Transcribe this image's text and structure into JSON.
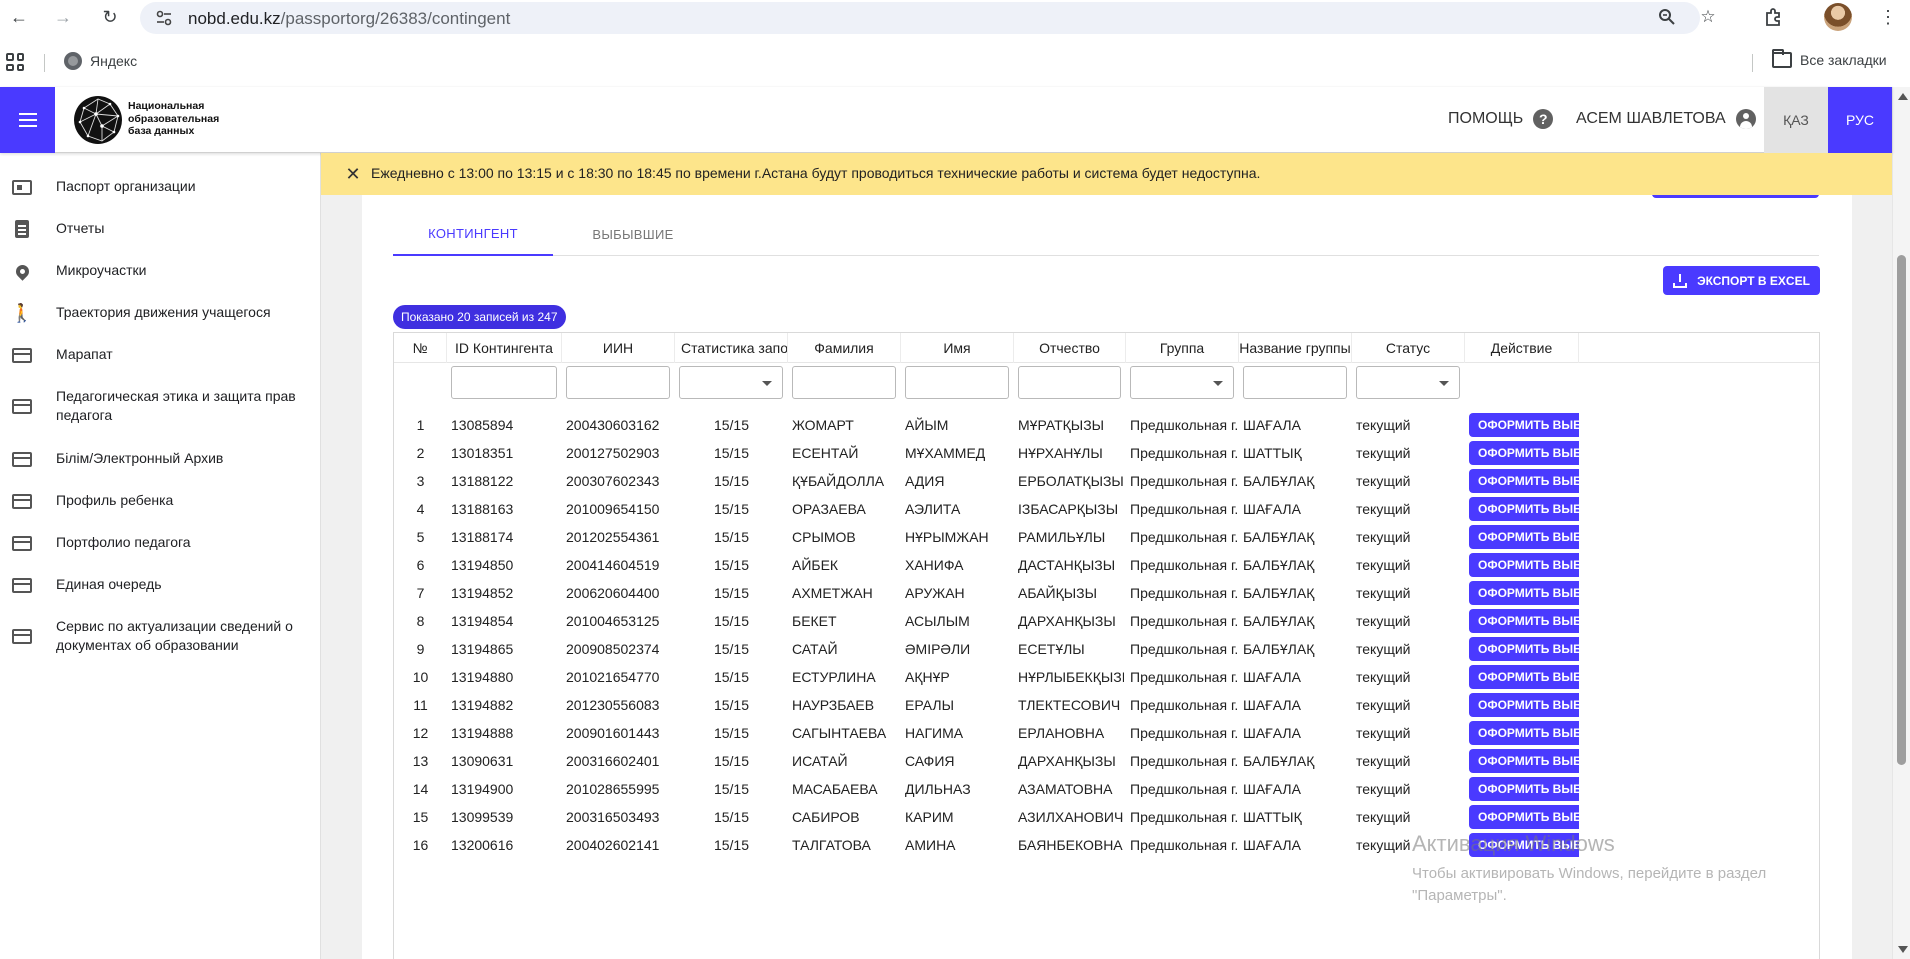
{
  "browser": {
    "url_host": "nobd.edu.kz",
    "url_path": "/passportorg/26383/contingent",
    "bookmark_yandex": "Яндекс",
    "all_bookmarks": "Все закладки"
  },
  "header": {
    "logo_text_1": "Национальная",
    "logo_text_2": "образовательная",
    "logo_text_3": "база данных",
    "help_label": "ПОМОЩЬ",
    "user_name": "АСЕМ ШАВЛЕТОВА",
    "lang_kaz": "ҚАЗ",
    "lang_rus": "РУС"
  },
  "sidebar": {
    "items": [
      {
        "label": "Паспорт организации",
        "icon": "id-card-icon"
      },
      {
        "label": "Отчеты",
        "icon": "clipboard-icon"
      },
      {
        "label": "Микроучастки",
        "icon": "map-pin-icon"
      },
      {
        "label": "Траектория движения учащегося",
        "icon": "walking-icon"
      },
      {
        "label": "Марапат",
        "icon": "table-icon"
      },
      {
        "label": "Педагогическая этика и защита прав педагога",
        "icon": "table-icon"
      },
      {
        "label": "Білім/Электронный Архив",
        "icon": "table-icon"
      },
      {
        "label": "Профиль ребенка",
        "icon": "table-icon"
      },
      {
        "label": "Портфолио педагога",
        "icon": "table-icon"
      },
      {
        "label": "Единая очередь",
        "icon": "table-icon"
      },
      {
        "label": "Сервис по актуализации сведений о документах об образовании",
        "icon": "table-icon"
      }
    ]
  },
  "banner": {
    "text": "Ежедневно с 13:00 по 13:15 и с 18:30 по 18:45 по времени г.Астана будут проводиться технические работы и система будет недоступна."
  },
  "tabs": [
    {
      "label": "КОНТИНГЕНТ",
      "active": true
    },
    {
      "label": "ВЫБЫВШИЕ",
      "active": false
    }
  ],
  "toolbar": {
    "export_label": "ЭКСПОРТ В EXCEL",
    "records_badge": "Показано 20 записей из 247"
  },
  "table": {
    "columns": [
      "№",
      "ID Контингента",
      "ИИН",
      "Статистика заполне",
      "Фамилия",
      "Имя",
      "Отчество",
      "Группа",
      "Название группы",
      "Статус",
      "Действие"
    ],
    "action_label": "ОФОРМИТЬ ВЫБЫТИ",
    "rows": [
      [
        "1",
        "13085894",
        "200430603162",
        "15/15",
        "ЖОМАРТ",
        "АЙЫМ",
        "МҰРАТҚЫЗЫ",
        "Предшкольная г...",
        "ШАҒАЛА",
        "текущий"
      ],
      [
        "2",
        "13018351",
        "200127502903",
        "15/15",
        "ЕСЕНТАЙ",
        "МҰХАММЕД",
        "НҰРХАНҰЛЫ",
        "Предшкольная г...",
        "ШАТТЫҚ",
        "текущий"
      ],
      [
        "3",
        "13188122",
        "200307602343",
        "15/15",
        "ҚҰБАЙДОЛЛА",
        "АДИЯ",
        "ЕРБОЛАТҚЫЗЫ",
        "Предшкольная г...",
        "БАЛБҰЛАҚ",
        "текущий"
      ],
      [
        "4",
        "13188163",
        "201009654150",
        "15/15",
        "ОРАЗАЕВА",
        "АЭЛИТА",
        "ІЗБАСАРҚЫЗЫ",
        "Предшкольная г...",
        "ШАҒАЛА",
        "текущий"
      ],
      [
        "5",
        "13188174",
        "201202554361",
        "15/15",
        "СРЫМОВ",
        "НҰРЫМЖАН",
        "РАМИЛЬҰЛЫ",
        "Предшкольная г...",
        "БАЛБҰЛАҚ",
        "текущий"
      ],
      [
        "6",
        "13194850",
        "200414604519",
        "15/15",
        "АЙБЕК",
        "ХАНИФА",
        "ДАСТАНҚЫЗЫ",
        "Предшкольная г...",
        "БАЛБҰЛАҚ",
        "текущий"
      ],
      [
        "7",
        "13194852",
        "200620604400",
        "15/15",
        "АХМЕТЖАН",
        "АРУЖАН",
        "АБАЙҚЫЗЫ",
        "Предшкольная г...",
        "БАЛБҰЛАҚ",
        "текущий"
      ],
      [
        "8",
        "13194854",
        "201004653125",
        "15/15",
        "БЕКЕТ",
        "АСЫЛЫМ",
        "ДАРХАНҚЫЗЫ",
        "Предшкольная г...",
        "БАЛБҰЛАҚ",
        "текущий"
      ],
      [
        "9",
        "13194865",
        "200908502374",
        "15/15",
        "САТАЙ",
        "ӘМІРӘЛИ",
        "ЕСЕТҰЛЫ",
        "Предшкольная г...",
        "БАЛБҰЛАҚ",
        "текущий"
      ],
      [
        "10",
        "13194880",
        "201021654770",
        "15/15",
        "ЕСТУРЛИНА",
        "АҚНҰР",
        "НҰРЛЫБЕКҚЫЗЫ",
        "Предшкольная г...",
        "ШАҒАЛА",
        "текущий"
      ],
      [
        "11",
        "13194882",
        "201230556083",
        "15/15",
        "НАУРЗБАЕВ",
        "ЕРАЛЫ",
        "ТЛЕКТЕСОВИЧ",
        "Предшкольная г...",
        "ШАҒАЛА",
        "текущий"
      ],
      [
        "12",
        "13194888",
        "200901601443",
        "15/15",
        "САГЫНТАЕВА",
        "НАГИМА",
        "ЕРЛАНОВНА",
        "Предшкольная г...",
        "ШАҒАЛА",
        "текущий"
      ],
      [
        "13",
        "13090631",
        "200316602401",
        "15/15",
        "ИСАТАЙ",
        "САФИЯ",
        "ДАРХАНҚЫЗЫ",
        "Предшкольная г...",
        "БАЛБҰЛАҚ",
        "текущий"
      ],
      [
        "14",
        "13194900",
        "201028655995",
        "15/15",
        "МАСАБАЕВА",
        "ДИЛЬНАЗ",
        "АЗАМАТОВНА",
        "Предшкольная г...",
        "ШАҒАЛА",
        "текущий"
      ],
      [
        "15",
        "13099539",
        "200316503493",
        "15/15",
        "САБИРОВ",
        "КАРИМ",
        "АЗИЛХАНОВИЧ",
        "Предшкольная г...",
        "ШАТТЫҚ",
        "текущий"
      ],
      [
        "16",
        "13200616",
        "200402602141",
        "15/15",
        "ТАЛГАТОВА",
        "АМИНА",
        "БАЯНБЕКОВНА",
        "Предшкольная г...",
        "ШАҒАЛА",
        "текущий"
      ]
    ]
  },
  "watermark": {
    "title": "Активация Windows",
    "subtitle": "Чтобы активировать Windows, перейдите в раздел \"Параметры\"."
  },
  "colors": {
    "accent": "#4a3aff",
    "banner": "#fde58b"
  }
}
